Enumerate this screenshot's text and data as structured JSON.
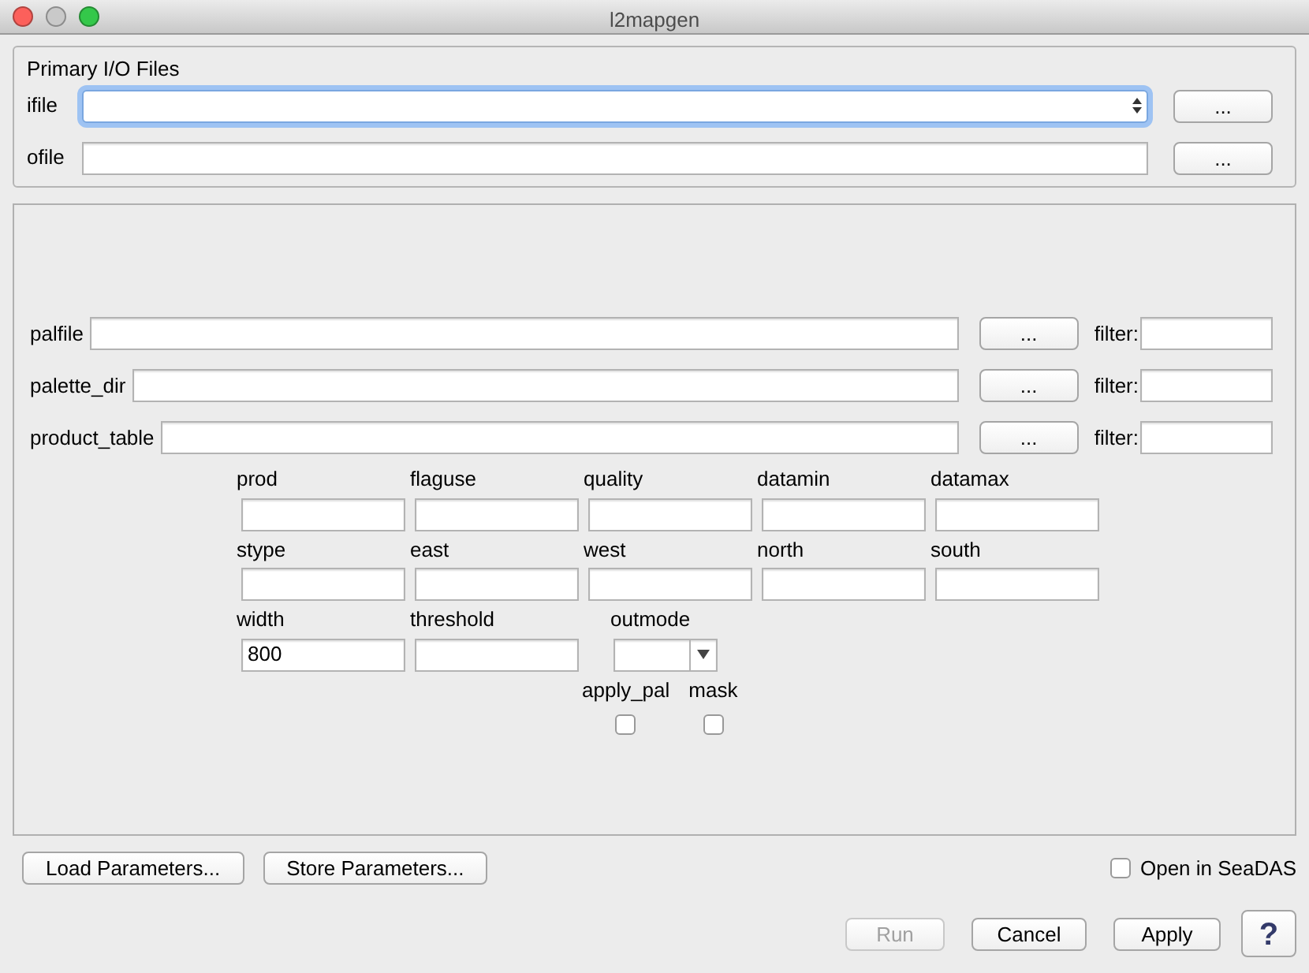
{
  "window": {
    "title": "l2mapgen"
  },
  "io_files": {
    "legend": "Primary I/O Files",
    "rows": [
      {
        "label": "ifile",
        "kind": "select",
        "focused": true,
        "button": "..."
      },
      {
        "label": "ofile",
        "kind": "text",
        "focused": false,
        "button": "..."
      }
    ]
  },
  "file_rows": [
    {
      "label": "palfile",
      "button": "...",
      "filter_label": "filter:"
    },
    {
      "label": "palette_dir",
      "button": "...",
      "filter_label": "filter:"
    },
    {
      "label": "product_table",
      "button": "...",
      "filter_label": "filter:"
    }
  ],
  "param_rows": [
    [
      {
        "label": "prod",
        "kind": "text"
      },
      {
        "label": "flaguse",
        "kind": "text"
      },
      {
        "label": "quality",
        "kind": "text"
      },
      {
        "label": "datamin",
        "kind": "text"
      },
      {
        "label": "datamax",
        "kind": "text"
      }
    ],
    [
      {
        "label": "stype",
        "kind": "text"
      },
      {
        "label": "east",
        "kind": "text"
      },
      {
        "label": "west",
        "kind": "text"
      },
      {
        "label": "north",
        "kind": "text"
      },
      {
        "label": "south",
        "kind": "text"
      }
    ],
    [
      {
        "label": "width",
        "kind": "text",
        "value": "800"
      },
      {
        "label": "threshold",
        "kind": "text"
      },
      {
        "label": "outmode",
        "kind": "select"
      }
    ],
    [
      {
        "label": "apply_pal",
        "kind": "checkbox",
        "checked": false
      },
      {
        "label": "mask",
        "kind": "checkbox",
        "checked": false
      }
    ]
  ],
  "param_buttons": [
    "Load Parameters...",
    "Store Parameters..."
  ],
  "open_in_seadas": {
    "label": "Open in SeaDAS",
    "checked": false
  },
  "actions": [
    {
      "label": "Run",
      "disabled": true
    },
    {
      "label": "Cancel",
      "disabled": false
    },
    {
      "label": "Apply",
      "disabled": false
    }
  ],
  "help_button": "?"
}
